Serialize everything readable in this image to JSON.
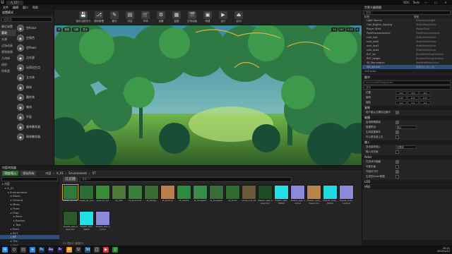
{
  "titlebar": {
    "logo": "U",
    "tab": "A_01*",
    "ddc": "DDC",
    "tools": "Tools",
    "min": "—",
    "max": "☐",
    "close": "✕"
  },
  "menu": [
    "文件",
    "编辑",
    "窗口",
    "帮助"
  ],
  "place": {
    "header": "放置模式",
    "search": "搜索类",
    "categories": [
      "最近放置",
      "基础",
      "光源",
      "过场动画",
      "视觉效果",
      "几何体",
      "体积",
      "所有类"
    ],
    "items": [
      "空Actor",
      "空角色",
      "空Pawn",
      "点光源",
      "玩家出生点",
      "立方体",
      "球体",
      "圆柱体",
      "锥体",
      "平面",
      "盒体触发器",
      "球体触发器"
    ]
  },
  "toolbar": [
    "保存当前关卡",
    "源码管理",
    "模式",
    "内容",
    "市场",
    "设置",
    "蓝图",
    "过场动画",
    "构建",
    "运行",
    "启动"
  ],
  "viewport": {
    "buttons": [
      "☰",
      "透视",
      "光照",
      "显示"
    ],
    "right": [
      "10",
      "10°",
      "0.25",
      "4"
    ]
  },
  "outliner": {
    "header": "世界大纲视图",
    "search": "搜索...",
    "col_label": "标签",
    "col_type": "类型",
    "rows": [
      {
        "n": "Light Source",
        "t": "DirectionalLight"
      },
      {
        "n": "Oak_English_Sapling",
        "t": "StaticMeshActor"
      },
      {
        "n": "Player Start",
        "t": "PlayerStart"
      },
      {
        "n": "PostProcessVolume",
        "t": "PostProcessVolume"
      },
      {
        "n": "rock_low",
        "t": "StaticMeshActor"
      },
      {
        "n": "rock_low2",
        "t": "StaticMeshActor"
      },
      {
        "n": "rock_low3",
        "t": "StaticMeshActor"
      },
      {
        "n": "rock_low4",
        "t": "StaticMeshActor"
      },
      {
        "n": "RVT_bs",
        "t": "RuntimeVirtualTexture"
      },
      {
        "n": "RVT_height",
        "t": "RuntimeVirtualTexture"
      },
      {
        "n": "SK_Mannequin",
        "t": "SkeletalMeshActor"
      },
      {
        "n": "SM_Sphere",
        "t": "编辑SM_Sky_Sp"
      }
    ],
    "status": "128 actor"
  },
  "details": {
    "header": "细节",
    "actor": "InstancedFoliageActor",
    "search": "搜索",
    "transform": [
      {
        "l": "位置",
        "v": [
          "0.0",
          "0.0",
          "0.0"
        ]
      },
      {
        "l": "旋转",
        "v": [
          "0.0°",
          "0.0°",
          "0.0°"
        ]
      },
      {
        "l": "缩放",
        "v": [
          "1.0",
          "1.0",
          "1.0"
        ]
      }
    ],
    "copy": "复制",
    "copy_row": "用户能从元素标记器中",
    "sec2": "碰撞",
    "rows2": [
      "启用物理模拟",
      "碰撞预设",
      "生成碰撞事件",
      "可以角色爬上去"
    ],
    "presets": "默认",
    "sec3": "输入",
    "rows3": [
      "自动接收输入",
      "输入优先级"
    ],
    "input_val": "已禁用",
    "sec4": "Actor",
    "rows4": [
      "在游戏中隐藏",
      "可被伤害",
      "开始时可行",
      "生成的Actor数据"
    ],
    "sec5": "LOD",
    "sec6": "烘焙"
  },
  "content": {
    "header": "内容浏览器",
    "add": "添加/导入",
    "save": "保存所有",
    "path": [
      "内容",
      "A_01",
      "Environment",
      "ST"
    ],
    "filter": "过滤器",
    "search": "搜索 ST",
    "tree": [
      "内容",
      "A_01",
      "Environment",
      "Block",
      "Ground",
      "Moss",
      "Plant",
      "Prop",
      "Brick",
      "Bucket",
      "Test",
      "Rock",
      "RVT",
      "ST",
      "Tile",
      "Wall",
      "Water"
    ],
    "assets": [
      {
        "n": "Asset_01_dec",
        "c": "#2f7a3a"
      },
      {
        "n": "Asset_01_bas",
        "c": "#2b6e34"
      },
      {
        "n": "guanmu_01",
        "c": "#3a8a3a"
      },
      {
        "n": "M_ddd",
        "c": "#4d7a36"
      },
      {
        "n": "M_guanmu1",
        "c": "#3c7e3c"
      },
      {
        "n": "M_Hedge",
        "c": "#3a6b35"
      },
      {
        "n": "M_shiRock",
        "c": "#b97e4c"
      },
      {
        "n": "M_tree01",
        "c": "#2e8a3e"
      },
      {
        "n": "M_Hedge01",
        "c": "#3a8a4a"
      },
      {
        "n": "M_Hedge02",
        "c": "#3a6b3a"
      },
      {
        "n": "M_Trunk",
        "c": "#306a30"
      },
      {
        "n": "shrub_low_01",
        "c": "#6b5a3a"
      },
      {
        "n": "Tree01_leaf_basecolor",
        "c": "#1e4a24"
      },
      {
        "n": "Tree01_leaf_MRAO",
        "c": "#22e0e8"
      },
      {
        "n": "Tree01_leaf_normal",
        "c": "#8a8ad8"
      },
      {
        "n": "Tree01_bark_basecolor",
        "c": "#b5854c"
      },
      {
        "n": "Tree01_bark_MRAO",
        "c": "#22d8e0"
      },
      {
        "n": "Tree01_bark_normal",
        "c": "#8a8ad8"
      },
      {
        "n": "Tree02_leaf_basecolor",
        "c": "#2a5a2a"
      },
      {
        "n": "Tree02_leaf_MRAO",
        "c": "#22e0e8"
      },
      {
        "n": "Tree02_leaf_normal",
        "c": "#8a8ad8"
      }
    ],
    "status": "21 项目(1 被选中)"
  },
  "taskbar": {
    "time": "20:21",
    "date": "2022/1/12",
    "icons": [
      "⊞",
      "○",
      "▭",
      "e",
      "Ps",
      "Ae",
      "Pr",
      "Ai",
      "U",
      "3d",
      "□",
      "▶",
      "♫"
    ],
    "colors": [
      "#1e90ff",
      "#333",
      "#444",
      "#1e88e5",
      "#0b3f6d",
      "#2c1a5d",
      "#2a1450",
      "#f7931e",
      "#333",
      "#0f5a8a",
      "#444",
      "#d33",
      "#2a8a2a"
    ]
  }
}
